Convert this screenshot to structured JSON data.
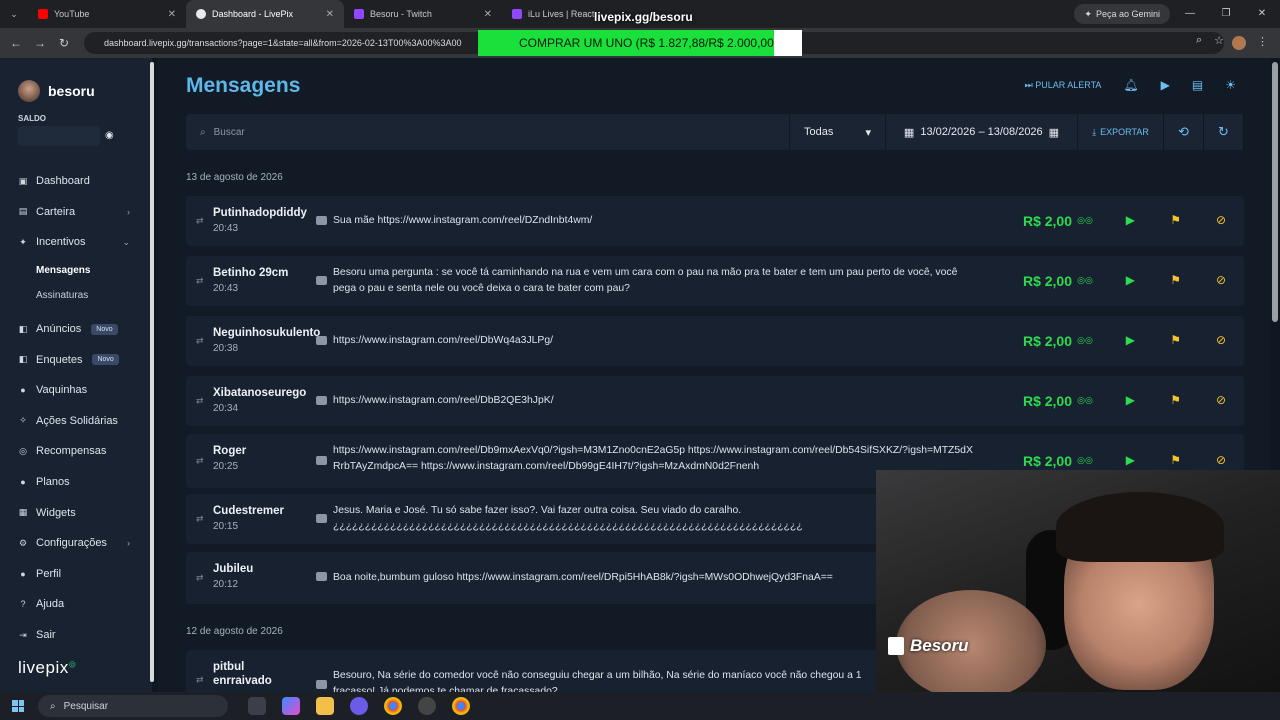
{
  "browser": {
    "tabs": [
      {
        "label": "YouTube",
        "color": "#ff0000",
        "active": false
      },
      {
        "label": "Dashboard - LivePix",
        "color": "#e8eaed",
        "active": true
      },
      {
        "label": "Besoru - Twitch",
        "color": "#9146ff",
        "active": false
      },
      {
        "label": "iLu Lives | React",
        "color": "#9146ff",
        "active": false
      }
    ],
    "gemini_label": "Peça ao Gemini",
    "url": "dashboard.livepix.gg/transactions?page=1&state=all&from=2026-02-13T00%3A00%3A00"
  },
  "overlay": {
    "title": "livepix.gg/besoru",
    "banner": "COMPRAR UM UNO (R$ 1.827,88/R$ 2.000,00)"
  },
  "sidebar": {
    "username": "besoru",
    "saldo_label": "SALDO",
    "items": [
      {
        "label": "Dashboard",
        "icon": "▣",
        "chevron": ""
      },
      {
        "label": "Carteira",
        "icon": "▤",
        "chevron": "›"
      },
      {
        "label": "Incentivos",
        "icon": "✦",
        "chevron": "⌄"
      }
    ],
    "sub_items": [
      {
        "label": "Mensagens",
        "active": true
      },
      {
        "label": "Assinaturas",
        "active": false
      }
    ],
    "items2": [
      {
        "label": "Anúncios",
        "icon": "◧",
        "badge": "Novo",
        "chevron": ""
      },
      {
        "label": "Enquetes",
        "icon": "◧",
        "badge": "Novo",
        "chevron": ""
      },
      {
        "label": "Vaquinhas",
        "icon": "●",
        "badge": "",
        "chevron": ""
      },
      {
        "label": "Ações Solidárias",
        "icon": "✧",
        "badge": "",
        "chevron": ""
      },
      {
        "label": "Recompensas",
        "icon": "◎",
        "badge": "",
        "chevron": ""
      },
      {
        "label": "Planos",
        "icon": "●",
        "badge": "",
        "chevron": ""
      },
      {
        "label": "Widgets",
        "icon": "▦",
        "badge": "",
        "chevron": ""
      },
      {
        "label": "Configurações",
        "icon": "⚙",
        "badge": "",
        "chevron": "›"
      },
      {
        "label": "Perfil",
        "icon": "●",
        "badge": "",
        "chevron": ""
      },
      {
        "label": "Ajuda",
        "icon": "?",
        "badge": "",
        "chevron": ""
      },
      {
        "label": "Sair",
        "icon": "⇥",
        "badge": "",
        "chevron": ""
      }
    ],
    "logo": "livepix"
  },
  "main": {
    "title": "Mensagens",
    "skip_alert_label": "PULAR ALERTA",
    "search_placeholder": "Buscar",
    "filter_value": "Todas",
    "date_range": "13/02/2026 – 13/08/2026",
    "export_label": "EXPORTAR",
    "date_groups": [
      "13 de agosto de 2026",
      "12 de agosto de 2026"
    ],
    "messages": [
      {
        "name": "Putinhadopdiddy",
        "time": "20:43",
        "text": "Sua mãe https://www.instagram.com/reel/DZndInbt4wm/",
        "amount": "R$ 2,00"
      },
      {
        "name": "Betinho 29cm",
        "time": "20:43",
        "text": "Besoru uma pergunta : se você tá caminhando na rua e vem um cara com o pau na mão pra te bater e tem um pau perto de você, você pega o pau e senta nele ou você deixa o cara te bater com pau?",
        "amount": "R$ 2,00"
      },
      {
        "name": "Neguinhosukulento",
        "time": "20:38",
        "text": "https://www.instagram.com/reel/DbWq4a3JLPg/",
        "amount": "R$ 2,00"
      },
      {
        "name": "Xibatanoseurego",
        "time": "20:34",
        "text": "https://www.instagram.com/reel/DbB2QE3hJpK/",
        "amount": "R$ 2,00"
      },
      {
        "name": "Roger",
        "time": "20:25",
        "text": "https://www.instagram.com/reel/Db9mxAexVq0/?igsh=M3M1Zno0cnE2aG5p https://www.instagram.com/reel/Db54SifSXKZ/?igsh=MTZ5dXRrbTAyZmdpcA== https://www.instagram.com/reel/Db99gE4IH7t/?igsh=MzAxdmN0d2Fnenh",
        "amount": "R$ 2,00"
      },
      {
        "name": "Cudestremer",
        "time": "20:15",
        "text": "Jesus. Maria e José. Tu só sabe fazer isso?. Vai fazer outra coisa. Seu viado do caralho.",
        "text2": "¿¿¿¿¿¿¿¿¿¿¿¿¿¿¿¿¿¿¿¿¿¿¿¿¿¿¿¿¿¿¿¿¿¿¿¿¿¿¿¿¿¿¿¿¿¿¿¿¿¿¿¿¿¿¿¿¿¿¿¿¿¿¿¿¿¿¿¿¿¿¿¿¿¿",
        "amount": ""
      },
      {
        "name": "Jubileu",
        "time": "20:12",
        "text": "Boa noite,bumbum guloso https://www.instagram.com/reel/DRpi5HhAB8k/?igsh=MWs0ODhwejQyd3FnaA==",
        "amount": ""
      },
      {
        "name": "pitbul enrraivado",
        "time": "",
        "text": "Besouro, Na série do comedor você não conseguiu chegar a um bilhão, Na série do maníaco você não chegou a 1",
        "text2": "fracasso! Já podemos te chamar de fracassado?",
        "amount": ""
      }
    ],
    "action_tts_label": "TTS"
  },
  "webcam": {
    "channel_label": "Besoru"
  },
  "taskbar": {
    "search_label": "Pesquisar"
  }
}
